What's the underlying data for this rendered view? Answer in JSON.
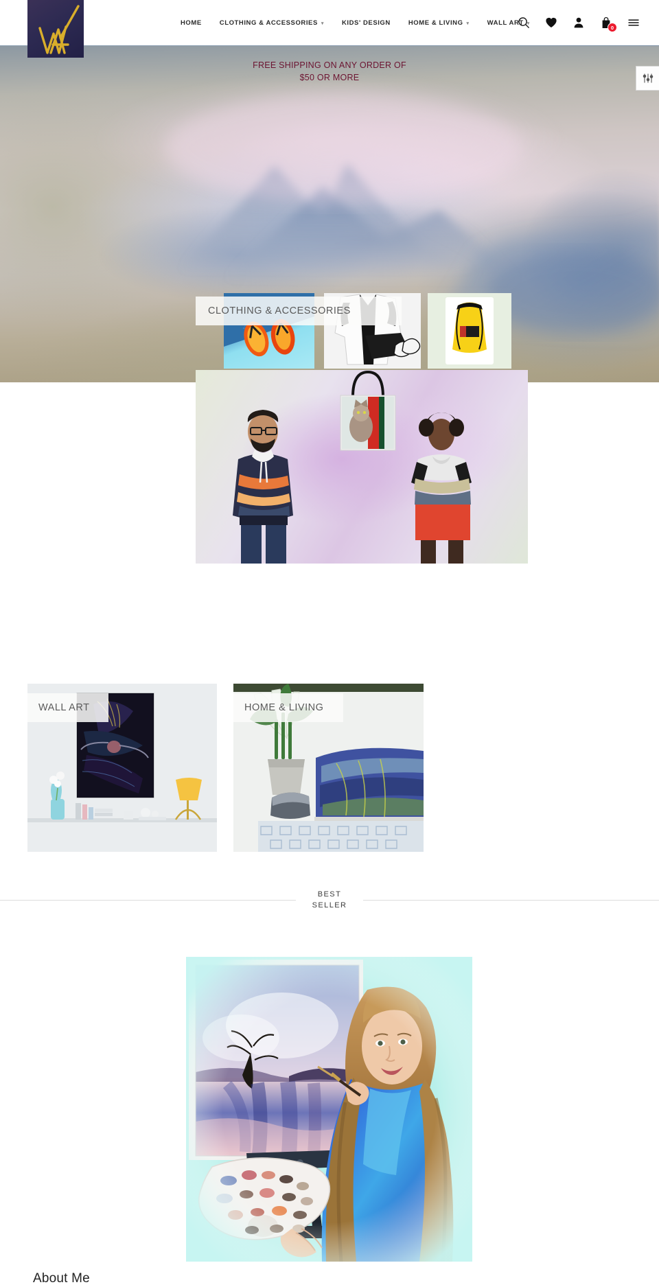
{
  "site": {
    "logo_name": "wa-monogram-logo",
    "logo_bg": "#2d2a52",
    "logo_stroke": "#d9ae2b"
  },
  "header": {
    "nav": [
      {
        "label": "HOME",
        "has_caret": false
      },
      {
        "label": "CLOTHING & ACCESSORIES",
        "has_caret": true
      },
      {
        "label": "KIDS' DESIGN",
        "has_caret": false
      },
      {
        "label": "HOME & LIVING",
        "has_caret": true
      },
      {
        "label": "WALL ART",
        "has_caret": true
      }
    ],
    "icons": [
      {
        "name": "search-icon",
        "label": "Search"
      },
      {
        "name": "wishlist-heart-icon",
        "label": "Wishlist"
      },
      {
        "name": "account-user-icon",
        "label": "Account"
      },
      {
        "name": "shopping-bag-icon",
        "label": "Cart"
      },
      {
        "name": "hamburger-menu-icon",
        "label": "Menu"
      }
    ],
    "cart_count": "0",
    "cart_badge_color": "#ec1b2e"
  },
  "hero": {
    "shipping_line1": "FREE SHIPPING ON ANY ORDER OF",
    "shipping_line2": "$50 OR MORE",
    "shipping_color": "#6b1330",
    "alt": "abstract pastel watercolor mountain landscape"
  },
  "widget": {
    "name": "settings-sliders-widget",
    "label": "Settings"
  },
  "categories": {
    "clothing": {
      "label": "CLOTHING & ACCESSORIES"
    },
    "wall_art": {
      "label": "WALL ART"
    },
    "home_living": {
      "label": "HOME & LIVING"
    }
  },
  "best_seller": {
    "line1": "BEST",
    "line2": "SELLER",
    "image_alt": "artist painting a pastel lake landscape on canvas"
  },
  "footer": {
    "about_title": "About Me"
  }
}
